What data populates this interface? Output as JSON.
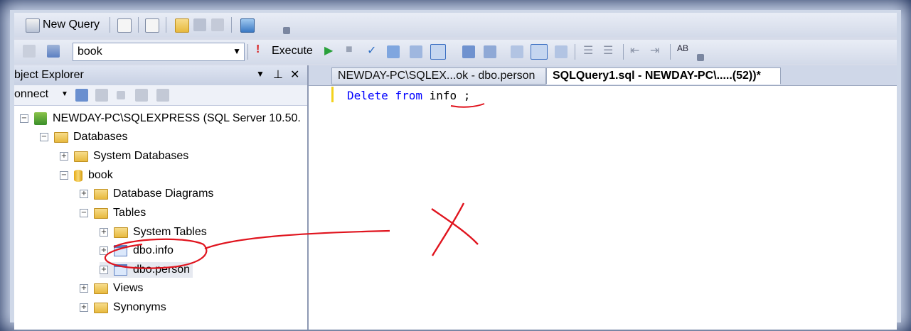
{
  "toolbar1": {
    "new_query_label": "New Query"
  },
  "toolbar2": {
    "database_value": "book",
    "execute_label": "Execute"
  },
  "object_explorer": {
    "title": "bject Explorer",
    "connect_label": "onnect",
    "pin_symbol": "− Ԅ ✕"
  },
  "tree": {
    "server": "NEWDAY-PC\\SQLEXPRESS (SQL Server 10.50.",
    "databases": "Databases",
    "system_databases": "System Databases",
    "book": "book",
    "database_diagrams": "Database Diagrams",
    "tables": "Tables",
    "system_tables": "System Tables",
    "dbo_info": "dbo.info",
    "dbo_person": "dbo.person",
    "views": "Views",
    "synonyms": "Synonyms"
  },
  "tabs": {
    "tab1": "NEWDAY-PC\\SQLEX...ok - dbo.person",
    "tab2": "SQLQuery1.sql - NEWDAY-PC\\.....(52))*"
  },
  "editor": {
    "kw_delete": "Delete",
    "kw_from": "from",
    "ident": "info",
    "semicolon": ";"
  },
  "colors": {
    "keyword": "#0000ff",
    "annotation": "#e0141e",
    "frame": "#0c1e4a"
  }
}
